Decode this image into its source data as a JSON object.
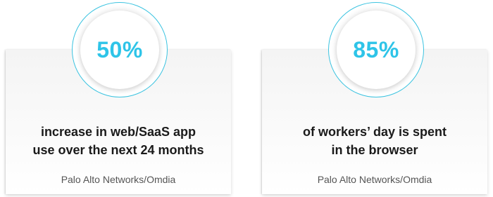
{
  "stats": [
    {
      "value": "50%",
      "description": "increase in web/SaaS app use over the next 24 months",
      "source": "Palo Alto Networks/Omdia"
    },
    {
      "value": "85%",
      "description": "of workers’ day is spent in the browser",
      "source": "Palo Alto Networks/Omdia"
    }
  ],
  "colors": {
    "accent": "#2ec4e8",
    "ring_border": "#3bc3e0",
    "text_dark": "#1a1a1a",
    "text_muted": "#555555"
  }
}
